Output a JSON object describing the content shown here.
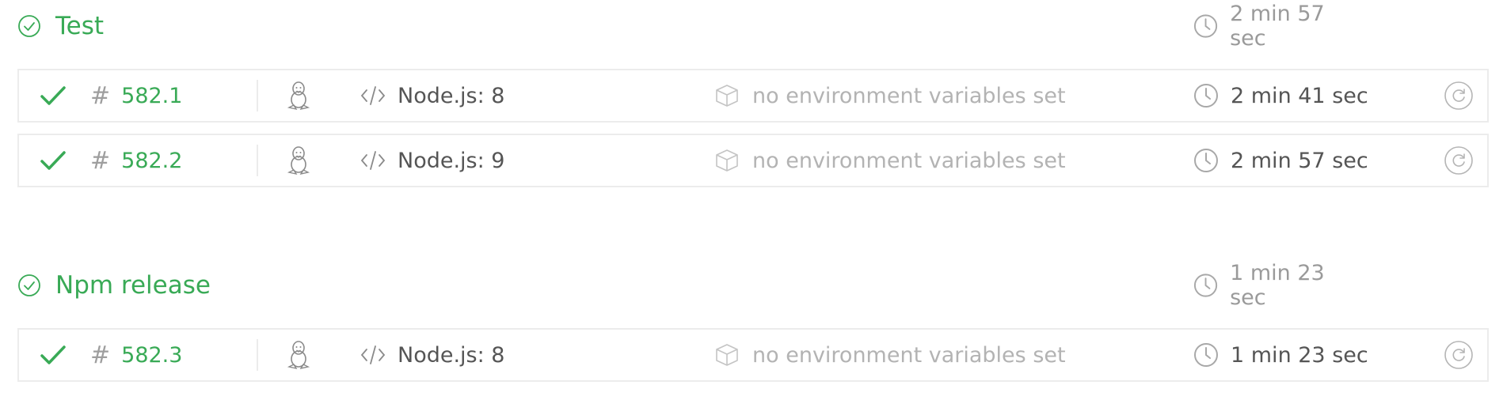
{
  "colors": {
    "success": "#39aa56",
    "muted": "#9a9a9a",
    "text": "#555555",
    "faint": "#b3b3b3",
    "border": "#ececec"
  },
  "stages": [
    {
      "title": "Test",
      "status_icon": "check-circle-icon",
      "duration": "2 min 57 sec",
      "jobs": [
        {
          "state_icon": "checkmark-icon",
          "hash": "#",
          "number": "582.1",
          "os_icon": "linux-tux-icon",
          "language": "Node.js: 8",
          "env": "no environment variables set",
          "duration": "2 min 41 sec",
          "restart_icon": "restart-icon"
        },
        {
          "state_icon": "checkmark-icon",
          "hash": "#",
          "number": "582.2",
          "os_icon": "linux-tux-icon",
          "language": "Node.js: 9",
          "env": "no environment variables set",
          "duration": "2 min 57 sec",
          "restart_icon": "restart-icon"
        }
      ]
    },
    {
      "title": "Npm release",
      "status_icon": "check-circle-icon",
      "duration": "1 min 23 sec",
      "jobs": [
        {
          "state_icon": "checkmark-icon",
          "hash": "#",
          "number": "582.3",
          "os_icon": "linux-tux-icon",
          "language": "Node.js: 8",
          "env": "no environment variables set",
          "duration": "1 min 23 sec",
          "restart_icon": "restart-icon"
        }
      ]
    }
  ]
}
